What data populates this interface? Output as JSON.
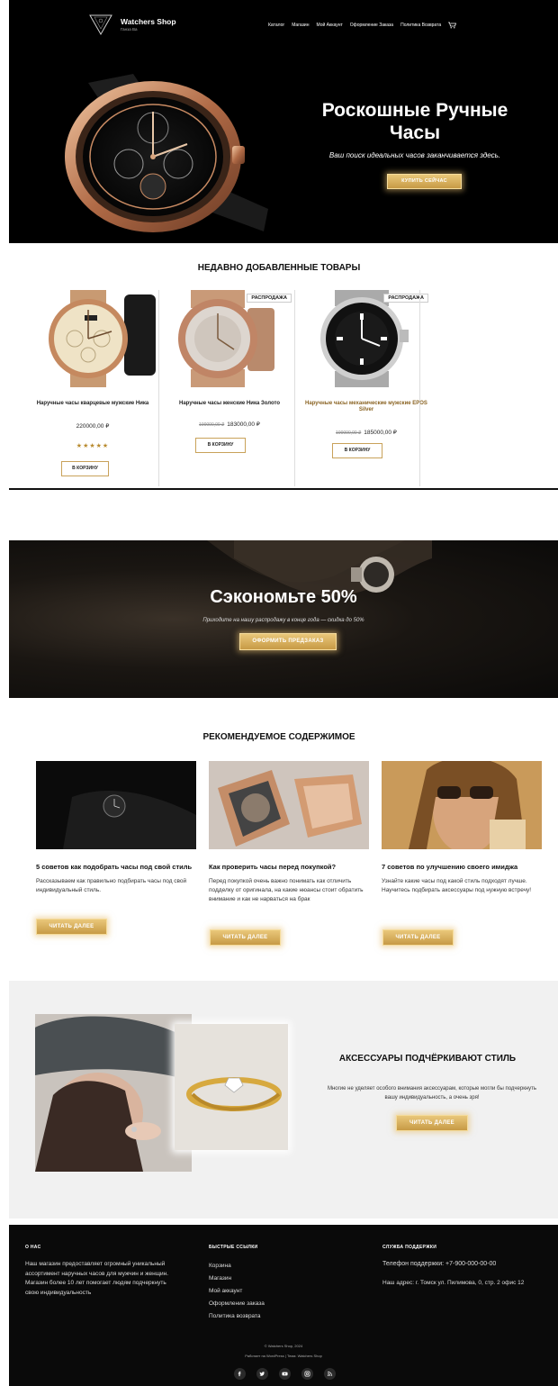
{
  "header": {
    "logo_title": "Watchers Shop",
    "logo_sub": "Ганза Ва",
    "nav": [
      "Каталог",
      "Магазин",
      "Мой Аккаунт",
      "Оформление Заказа",
      "Политика Возврата"
    ],
    "cart_icon": "cart-icon"
  },
  "hero": {
    "title": "Роскошные Ручные Часы",
    "subtitle": "Ваш поиск идеальных часов заканчивается здесь.",
    "button": "КУПИТЬ СЕЙЧАС"
  },
  "recent": {
    "title": "НЕДАВНО ДОБАВЛЕННЫЕ ТОВАРЫ",
    "products": [
      {
        "name": "Наручные часы кварцевые мужские Ника",
        "price": "220000,00 ₽",
        "old_price": "",
        "sale": "",
        "rating_stars": 5,
        "stars": "★★★★★",
        "button": "В КОРЗИНУ"
      },
      {
        "name": "Наручные часы женские Ника Золото",
        "price": "183000,00 ₽",
        "old_price": "190000,00 ₽",
        "sale": "РАСПРОДАЖА",
        "button": "В КОРЗИНУ"
      },
      {
        "name": "Наручные часы механические мужские EPOS Silver",
        "price": "185000,00 ₽",
        "old_price": "190000,00 ₽",
        "sale": "РАСПРОДАЖА",
        "button": "В КОРЗИНУ"
      }
    ]
  },
  "promo": {
    "title": "Сэкономьте 50%",
    "subtitle": "Приходите на нашу распродажу в конце года — скидка до 50%",
    "button": "ОФОРМИТЬ ПРЕДЗАКАЗ"
  },
  "featured": {
    "title": "РЕКОМЕНДУЕМОЕ СОДЕРЖИМОЕ",
    "posts": [
      {
        "title": "5 советов как подобрать часы под свой стиль",
        "text": "Рассказываем как правильно подбирать часы под свой индивидуальный стиль.",
        "button": "ЧИТАТЬ ДАЛЕЕ"
      },
      {
        "title": "Как проверить часы перед покупкой?",
        "text": "Перед покупкой очень важно понимать как отличить подделку от оригинала, на какие нюансы стоит обратить внимание и как не нарваться на брак",
        "button": "ЧИТАТЬ ДАЛЕЕ"
      },
      {
        "title": "7 советов по улучшению своего имиджа",
        "text": "Узнайте какие часы под какой стиль подходят лучше. Научитесь подбирать аксессуары под нужную встречу!",
        "button": "ЧИТАТЬ ДАЛЕЕ"
      }
    ]
  },
  "accessories": {
    "title": "АКСЕССУАРЫ ПОДЧЁРКИВАЮТ СТИЛЬ",
    "text": "Многие не уделяет особого внимания аксессуарам, которые могли бы подчеркнуть вашу индивидуальность, а очень зря!",
    "button": "ЧИТАТЬ ДАЛЕЕ"
  },
  "footer": {
    "about_head": "О НАС",
    "about_text": "Наш магазин предоставляет огромный уникальный ассортимент наручных часов для мужчин и женщин. Магазин более 10 лет помогает людям подчеркнуть свою индивидуальность",
    "links_head": "БЫСТРЫЕ ССЫЛКИ",
    "links": [
      "Корзина",
      "Магазин",
      "Мой аккаунт",
      "Оформление заказа",
      "Политика возврата"
    ],
    "support_head": "СЛУЖБА ПОДДЕРЖКИ",
    "phone": "Телефон поддержки: +7-900-000-00-00",
    "address": "Наш адрес: г. Томск ул. Пилимова, 0, стр. 2 офис 12",
    "copyright": "© Watchers Shop, 2024",
    "credit": "Работает на WordPress | Тема: Watchers Shop",
    "social": [
      "facebook-icon",
      "twitter-icon",
      "youtube-icon",
      "instagram-icon",
      "rss-icon"
    ]
  },
  "colors": {
    "gold": "#c9a25a",
    "dark": "#000000",
    "light_section": "#f1f1f1"
  }
}
